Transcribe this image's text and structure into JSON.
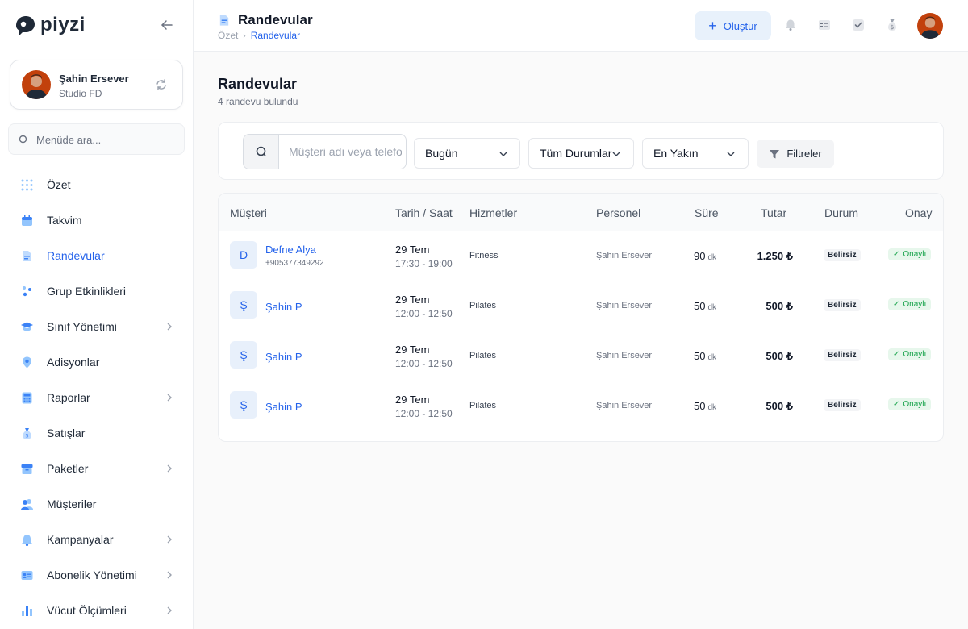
{
  "brand": {
    "name": "piyzi"
  },
  "profile": {
    "name": "Şahin Ersever",
    "studio": "Studio FD"
  },
  "menu_search": {
    "placeholder": "Menüde ara..."
  },
  "nav": [
    {
      "label": "Özet",
      "icon": "grid-icon",
      "chevron": false
    },
    {
      "label": "Takvim",
      "icon": "calendar-icon",
      "chevron": false
    },
    {
      "label": "Randevular",
      "icon": "document-icon",
      "chevron": false,
      "active": true
    },
    {
      "label": "Grup Etkinlikleri",
      "icon": "group-icon",
      "chevron": false
    },
    {
      "label": "Sınıf Yönetimi",
      "icon": "graduation-cap-icon",
      "chevron": true
    },
    {
      "label": "Adisyonlar",
      "icon": "location-pin-icon",
      "chevron": false
    },
    {
      "label": "Raporlar",
      "icon": "calculator-icon",
      "chevron": true
    },
    {
      "label": "Satışlar",
      "icon": "money-bag-icon",
      "chevron": false
    },
    {
      "label": "Paketler",
      "icon": "package-icon",
      "chevron": true
    },
    {
      "label": "Müşteriler",
      "icon": "users-icon",
      "chevron": false
    },
    {
      "label": "Kampanyalar",
      "icon": "megaphone-icon",
      "chevron": true
    },
    {
      "label": "Abonelik Yönetimi",
      "icon": "id-card-icon",
      "chevron": true
    },
    {
      "label": "Vücut Ölçümleri",
      "icon": "bar-chart-icon",
      "chevron": true
    }
  ],
  "header": {
    "title": "Randevular",
    "breadcrumb": [
      "Özet",
      "Randevular"
    ],
    "create_label": "Oluştur"
  },
  "page": {
    "title": "Randevular",
    "subtitle": "4 randevu bulundu"
  },
  "filters": {
    "search_placeholder": "Müşteri adı veya telefon",
    "date": "Bugün",
    "status": "Tüm Durumlar",
    "sort": "En Yakın",
    "button": "Filtreler"
  },
  "table": {
    "columns": [
      "Müşteri",
      "Tarih / Saat",
      "Hizmetler",
      "Personel",
      "Süre",
      "Tutar",
      "Durum",
      "Onay"
    ],
    "duration_unit": "dk",
    "rows": [
      {
        "initial": "D",
        "name": "Defne Alya",
        "phone": "+905377349292",
        "date": "29 Tem",
        "time": "17:30 - 19:00",
        "service": "Fitness",
        "staff": "Şahin Ersever",
        "duration": "90",
        "amount": "1.250 ₺",
        "status": "Belirsiz",
        "approval": "Onaylı"
      },
      {
        "initial": "Ş",
        "name": "Şahin P",
        "phone": "",
        "date": "29 Tem",
        "time": "12:00 - 12:50",
        "service": "Pilates",
        "staff": "Şahin Ersever",
        "duration": "50",
        "amount": "500 ₺",
        "status": "Belirsiz",
        "approval": "Onaylı"
      },
      {
        "initial": "Ş",
        "name": "Şahin P",
        "phone": "",
        "date": "29 Tem",
        "time": "12:00 - 12:50",
        "service": "Pilates",
        "staff": "Şahin Ersever",
        "duration": "50",
        "amount": "500 ₺",
        "status": "Belirsiz",
        "approval": "Onaylı"
      },
      {
        "initial": "Ş",
        "name": "Şahin P",
        "phone": "",
        "date": "29 Tem",
        "time": "12:00 - 12:50",
        "service": "Pilates",
        "staff": "Şahin Ersever",
        "duration": "50",
        "amount": "500 ₺",
        "status": "Belirsiz",
        "approval": "Onaylı"
      }
    ]
  },
  "colors": {
    "accent": "#2563eb",
    "success": "#16a34a"
  }
}
